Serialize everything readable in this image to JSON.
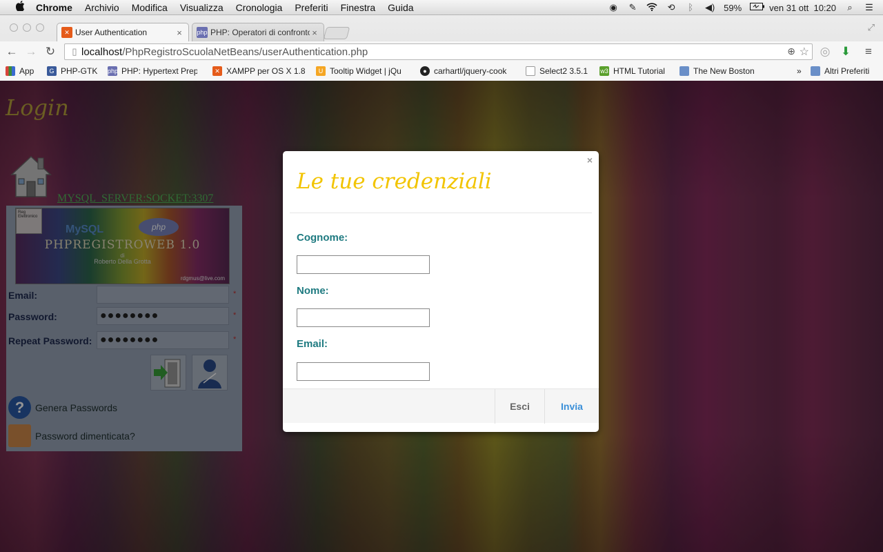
{
  "menubar": {
    "apple": "",
    "items": [
      "Chrome",
      "Archivio",
      "Modifica",
      "Visualizza",
      "Cronologia",
      "Preferiti",
      "Finestra",
      "Guida"
    ],
    "battery": "59%",
    "datetime": "ven 31 ott  10:20"
  },
  "tabs": [
    {
      "title": "User Authentication",
      "icon": "xampp-icon",
      "color": "#e55b1a"
    },
    {
      "title": "PHP: Operatori di confronto",
      "icon": "php-icon",
      "color": "#6a6fb0"
    }
  ],
  "address": {
    "host": "localhost",
    "path": "/PhpRegistroScuolaNetBeans/userAuthentication.php"
  },
  "bookmarks": [
    {
      "label": "App",
      "icon": "apps-grid-icon",
      "color": "#d9443c"
    },
    {
      "label": "PHP-GTK",
      "icon": "php-gtk-icon",
      "color": "#3a5a9a"
    },
    {
      "label": "PHP: Hypertext Prep",
      "icon": "php-icon",
      "color": "#6a6fb0"
    },
    {
      "label": "XAMPP per OS X 1.8",
      "icon": "xampp-icon",
      "color": "#e55b1a"
    },
    {
      "label": "Tooltip Widget | jQu",
      "icon": "jquery-ui-icon",
      "color": "#f5a623"
    },
    {
      "label": "carhartl/jquery-cook",
      "icon": "github-icon",
      "color": "#222222"
    },
    {
      "label": "Select2 3.5.1",
      "icon": "page-icon",
      "color": "#999999"
    },
    {
      "label": "HTML Tutorial",
      "icon": "w3schools-icon",
      "color": "#5aa02c"
    },
    {
      "label": "The New Boston",
      "icon": "folder-icon",
      "color": "#6a8fc8"
    }
  ],
  "bookmarks_overflow": "»",
  "bookmarks_other": "Altri Preferiti",
  "page": {
    "login_title": "Login",
    "server_link": "MYSQL_SERVER:SOCKET:3307",
    "banner": {
      "logo_text": "Reg Elettronico",
      "mysql": "MySQL",
      "php": "php",
      "title": "PHPREGISTROWEB 1.0",
      "di": "di",
      "author": "Roberto Della Grotta",
      "mail": "rdgmus@live.com"
    },
    "form": {
      "email_label": "Email:",
      "password_label": "Password:",
      "repeat_label": "Repeat Password:",
      "password_value": "●●●●●●●●",
      "repeat_value": "●●●●●●●●",
      "required": "*"
    },
    "links": {
      "genera": "Genera Passwords",
      "dimenticata": "Password dimenticata?"
    }
  },
  "modal": {
    "close": "×",
    "title": "Le tue credenziali",
    "cognome_label": "Cognome:",
    "nome_label": "Nome:",
    "email_label": "Email:",
    "esci": "Esci",
    "invia": "Invia"
  },
  "colors": {
    "modal_title": "#f2c400",
    "modal_label": "#1e7a80",
    "invia": "#3a8fd8",
    "esci": "#666666",
    "server_link": "#53b85a",
    "login_title": "#b9a23c"
  }
}
